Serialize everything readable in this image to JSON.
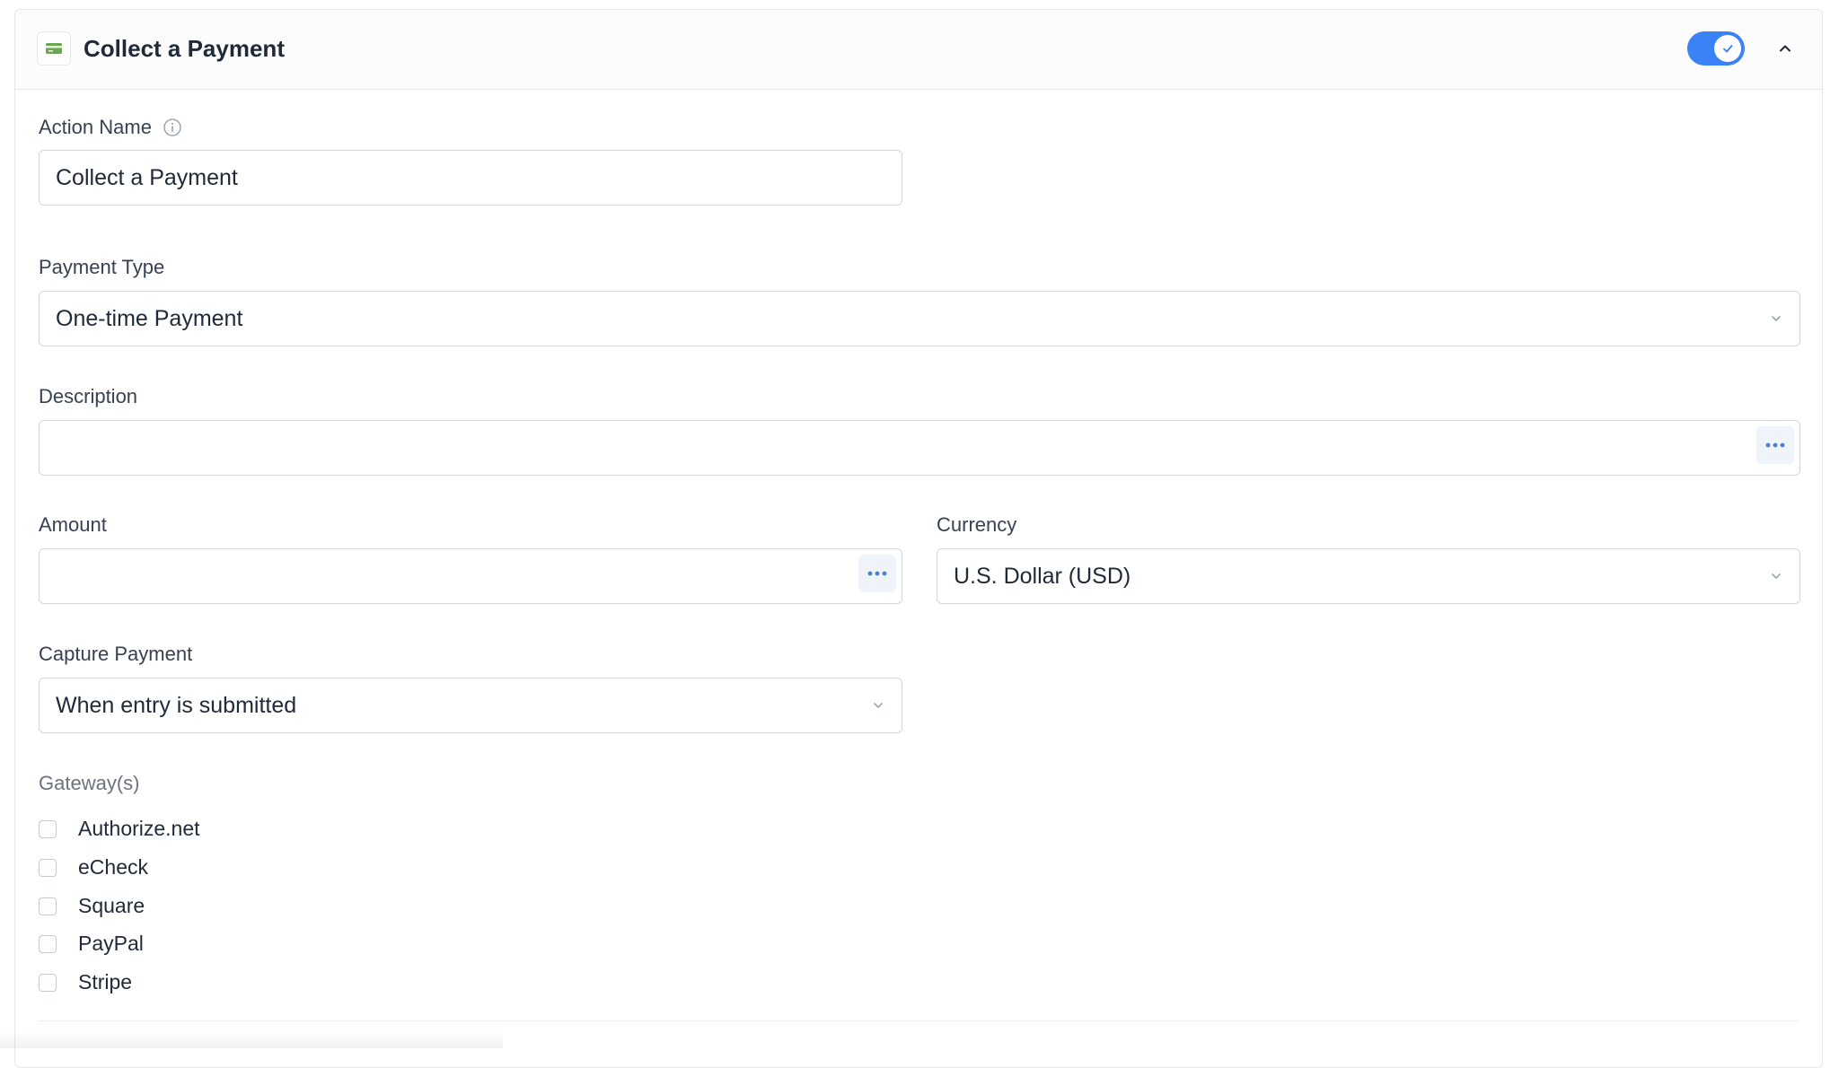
{
  "header": {
    "title": "Collect a Payment",
    "icon": "credit-card-icon",
    "icon_color": "#6aa84f",
    "toggle_on": true,
    "toggle_color": "#3b82f6"
  },
  "action_name": {
    "label": "Action Name",
    "value": "Collect a Payment"
  },
  "payment_type": {
    "label": "Payment Type",
    "value": "One-time Payment"
  },
  "description": {
    "label": "Description",
    "value": ""
  },
  "amount": {
    "label": "Amount",
    "value": ""
  },
  "currency": {
    "label": "Currency",
    "value": "U.S. Dollar (USD)"
  },
  "capture_payment": {
    "label": "Capture Payment",
    "value": "When entry is submitted"
  },
  "gateways": {
    "label": "Gateway(s)",
    "items": [
      {
        "label": "Authorize.net",
        "checked": false
      },
      {
        "label": "eCheck",
        "checked": false
      },
      {
        "label": "Square",
        "checked": false
      },
      {
        "label": "PayPal",
        "checked": false
      },
      {
        "label": "Stripe",
        "checked": false
      }
    ]
  }
}
